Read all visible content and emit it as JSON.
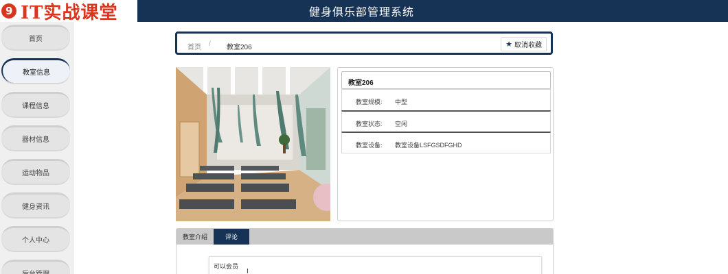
{
  "header": {
    "logo_text": "IT实战课堂",
    "title": "健身俱乐部管理系统"
  },
  "sidebar": {
    "items": [
      {
        "label": "首页"
      },
      {
        "label": "教室信息"
      },
      {
        "label": "课程信息"
      },
      {
        "label": "器材信息"
      },
      {
        "label": "运动物品"
      },
      {
        "label": "健身资讯"
      },
      {
        "label": "个人中心"
      },
      {
        "label": "后台管理"
      }
    ],
    "active_index": 1
  },
  "breadcrumb": {
    "home": "首页",
    "separator": "/",
    "current": "教室206"
  },
  "favorite_button": {
    "icon": "star-icon",
    "label": "取消收藏"
  },
  "room": {
    "image": "yoga-studio-photo",
    "title": "教室206",
    "fields": [
      {
        "label": "教室规模:",
        "value": "中型"
      },
      {
        "label": "教室状态:",
        "value": "空闲"
      },
      {
        "label": "教室设备:",
        "value": "教室设备LSFGSDFGHD"
      }
    ]
  },
  "tabs": {
    "items": [
      {
        "label": "教室介绍"
      },
      {
        "label": "评论"
      }
    ],
    "active_index": 1
  },
  "comment": {
    "text": "可以会员",
    "cursor": "I"
  },
  "colors": {
    "primary": "#163356",
    "logo_red": "#d9361f",
    "sidebar_bg": "#f0f0f0",
    "tabs_bar": "#c9c9c9"
  }
}
